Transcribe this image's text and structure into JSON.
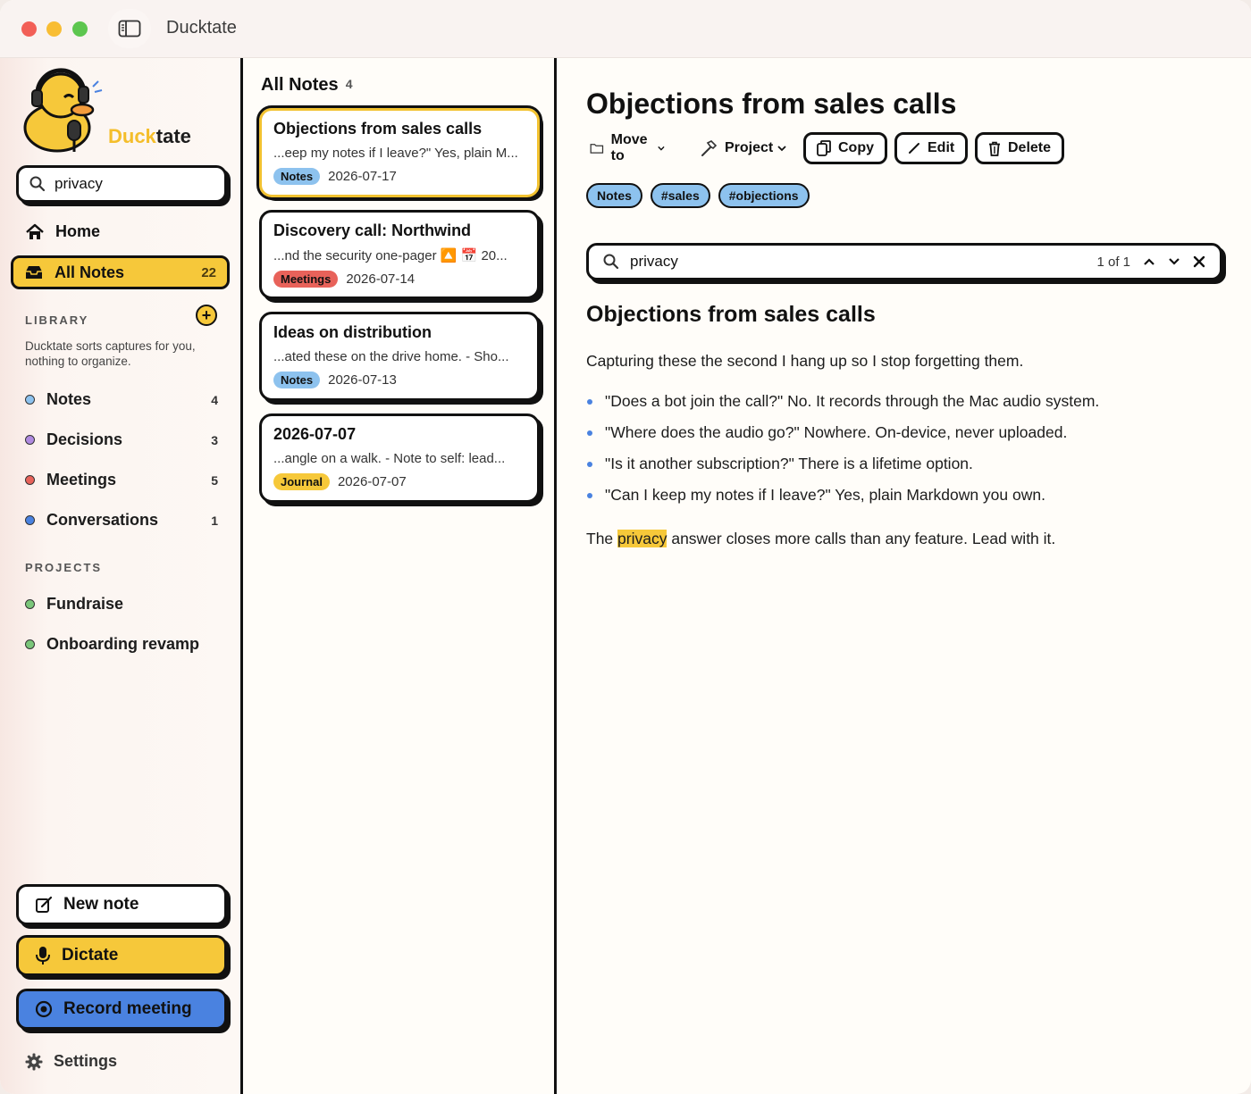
{
  "window": {
    "title": "Ducktate"
  },
  "sidebar": {
    "brand_part1": "Duck",
    "brand_part2": "tate",
    "search_value": "privacy",
    "home_label": "Home",
    "all_notes": {
      "label": "All Notes",
      "count": "22"
    },
    "library": {
      "label": "LIBRARY",
      "description": "Ducktate sorts captures for you, nothing to organize.",
      "items": [
        {
          "label": "Notes",
          "count": "4",
          "color": "#8dc2ee"
        },
        {
          "label": "Decisions",
          "count": "3",
          "color": "#b08ae0"
        },
        {
          "label": "Meetings",
          "count": "5",
          "color": "#e8625a"
        },
        {
          "label": "Conversations",
          "count": "1",
          "color": "#4a82e0"
        }
      ]
    },
    "projects": {
      "label": "PROJECTS",
      "items": [
        {
          "label": "Fundraise",
          "color": "#7ac67a"
        },
        {
          "label": "Onboarding revamp",
          "color": "#7ac67a"
        }
      ]
    },
    "new_note": "New note",
    "dictate": "Dictate",
    "record_meeting": "Record meeting",
    "settings": "Settings"
  },
  "list": {
    "title": "All Notes",
    "count": "4",
    "notes": [
      {
        "title": "Objections from sales calls",
        "snippet": "...eep my notes if I leave?\" Yes, plain M...",
        "tag": "Notes",
        "date": "2026-07-17"
      },
      {
        "title": "Discovery call: Northwind",
        "snippet": "...nd the security one-pager 🔼 📅 20...",
        "tag": "Meetings",
        "date": "2026-07-14"
      },
      {
        "title": "Ideas on distribution",
        "snippet": "...ated these on the drive home.  - Sho...",
        "tag": "Notes",
        "date": "2026-07-13"
      },
      {
        "title": "2026-07-07",
        "snippet": "...angle on a walk. - Note to self: lead...",
        "tag": "Journal",
        "date": "2026-07-07"
      }
    ]
  },
  "detail": {
    "title": "Objections from sales calls",
    "toolbar": {
      "move_to": "Move to",
      "project": "Project",
      "copy": "Copy",
      "edit": "Edit",
      "delete": "Delete"
    },
    "tags": [
      "Notes",
      "#sales",
      "#objections"
    ],
    "find": {
      "query": "privacy",
      "position": "1 of 1"
    },
    "heading": "Objections from sales calls",
    "intro": "Capturing these the second I hang up so I stop forgetting them.",
    "bullets": [
      "\"Does a bot join the call?\" No. It records through the Mac audio system.",
      "\"Where does the audio go?\" Nowhere. On-device, never uploaded.",
      "\"Is it another subscription?\" There is a lifetime option.",
      "\"Can I keep my notes if I leave?\" Yes, plain Markdown you own."
    ],
    "closing_before": "The ",
    "closing_highlight": "privacy",
    "closing_after": " answer closes more calls than any feature. Lead with it."
  }
}
